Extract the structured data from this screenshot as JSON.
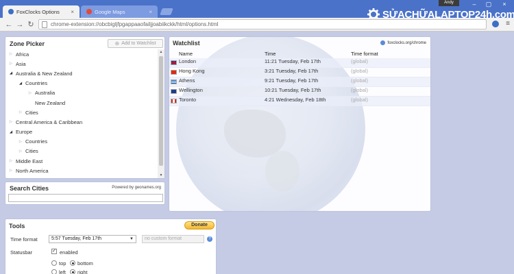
{
  "browser": {
    "tabs": [
      {
        "label": "FoxClocks Options",
        "active": true
      },
      {
        "label": "Google Maps",
        "active": false
      }
    ],
    "user": "Andy",
    "url": "chrome-extension://obcbigljfpgappaaofailjjoabiikckk/html/options.html",
    "watermark": "SỬACHỮALAPTOP24h.com"
  },
  "zone_picker": {
    "title": "Zone Picker",
    "add_button": "Add to Watchlist",
    "items": [
      {
        "label": "Africa",
        "expanded": false
      },
      {
        "label": "Asia",
        "expanded": false
      },
      {
        "label": "Australia & New Zealand",
        "expanded": true
      },
      {
        "label": "Countries",
        "expanded": true
      },
      {
        "label": "Australia",
        "expanded": false
      },
      {
        "label": "New Zealand",
        "expanded": null
      },
      {
        "label": "Cities",
        "expanded": false
      },
      {
        "label": "Central America & Caribbean",
        "expanded": false
      },
      {
        "label": "Europe",
        "expanded": true
      },
      {
        "label": "Countries",
        "expanded": false
      },
      {
        "label": "Cities",
        "expanded": false
      },
      {
        "label": "Middle East",
        "expanded": false
      },
      {
        "label": "North America",
        "expanded": false
      }
    ]
  },
  "search": {
    "title": "Search Cities",
    "powered": "Powered by geonames.org",
    "value": ""
  },
  "watchlist": {
    "title": "Watchlist",
    "link": "foxclocks.org/chrome",
    "columns": [
      "Name",
      "Time",
      "Time format"
    ],
    "rows": [
      {
        "name": "London",
        "time": "11:21 Tuesday, Feb 17th",
        "format": "(global)"
      },
      {
        "name": "Hong Kong",
        "time": "3:21 Tuesday, Feb 17th",
        "format": "(global)"
      },
      {
        "name": "Athens",
        "time": "9:21 Tuesday, Feb 17th",
        "format": "(global)"
      },
      {
        "name": "Wellington",
        "time": "10:21 Tuesday, Feb 17th",
        "format": "(global)"
      },
      {
        "name": "Toronto",
        "time": "4:21 Wednesday, Feb 18th",
        "format": "(global)"
      }
    ]
  },
  "tools": {
    "title": "Tools",
    "donate": "Donate",
    "time_format_label": "Time format",
    "time_format_value": "5:57 Tuesday, Feb 17th",
    "custom_format_placeholder": "no custom format",
    "help": "?",
    "statusbar_label": "Statusbar",
    "enabled_label": "enabled",
    "enabled": true,
    "top_label": "top",
    "bottom_label": "bottom",
    "left_label": "left",
    "right_label": "right",
    "vertical_position": "bottom",
    "horizontal_position": "right"
  }
}
